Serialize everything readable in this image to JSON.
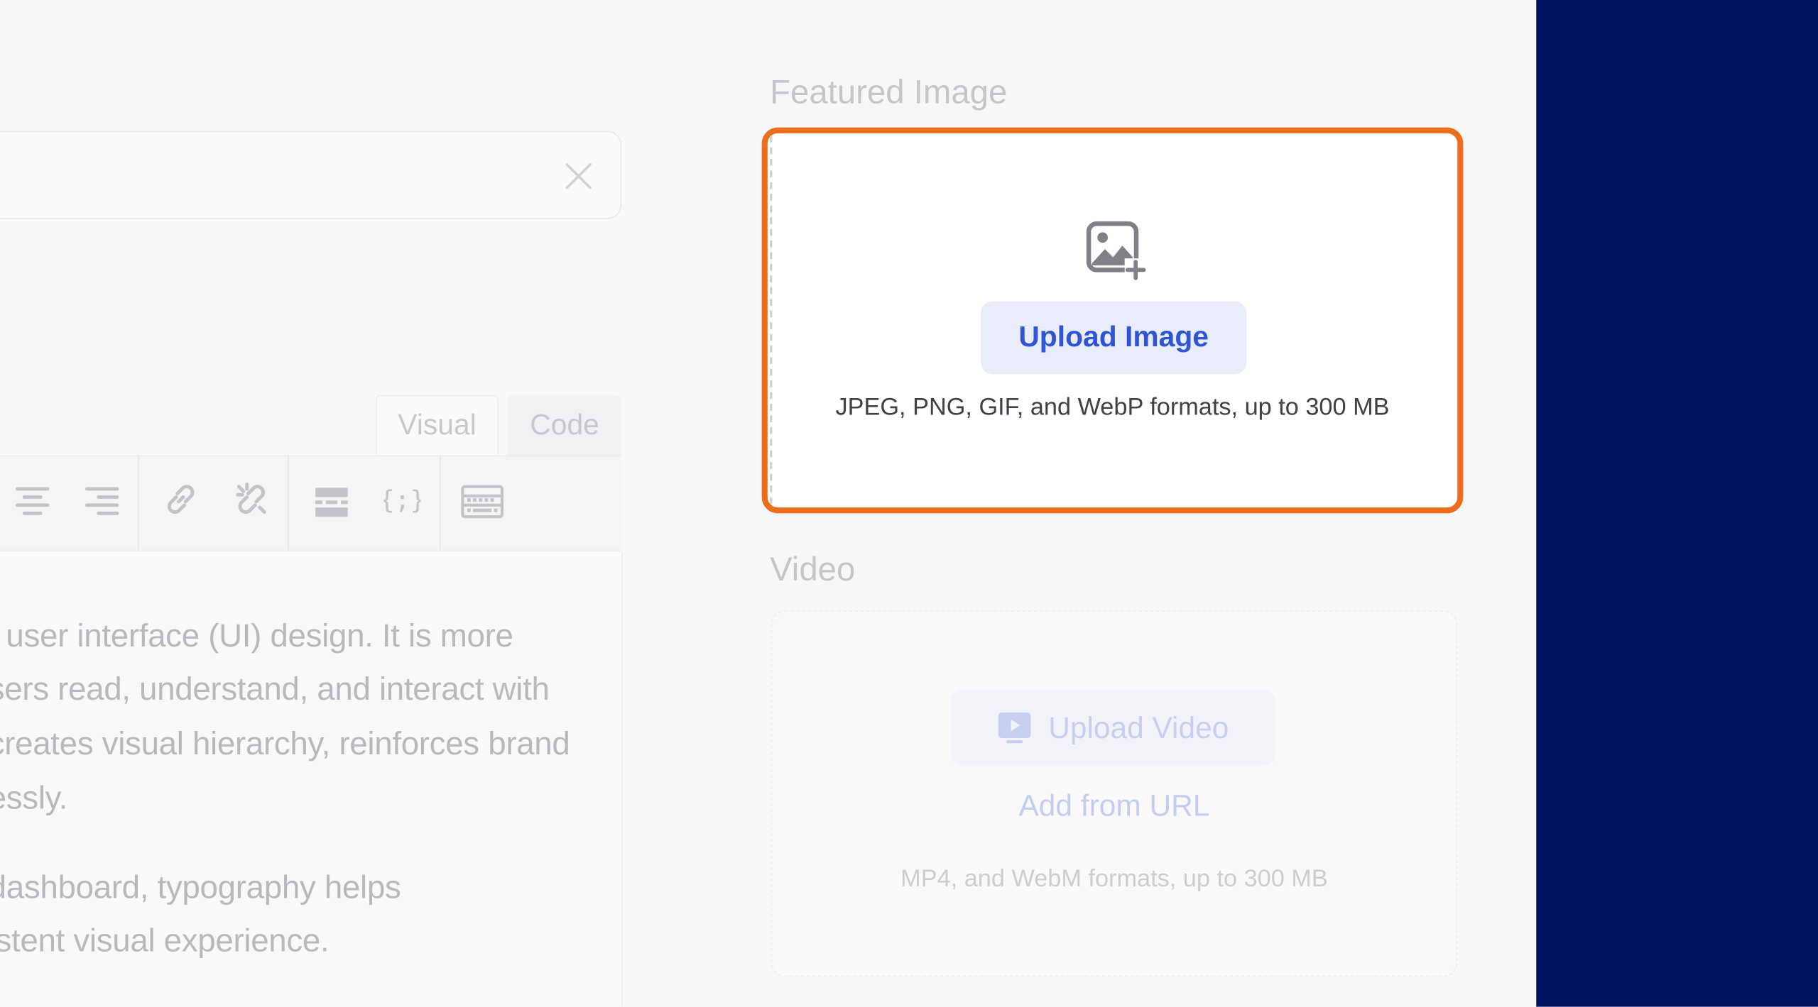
{
  "editor": {
    "tabs": [
      {
        "label": "Visual",
        "active": true
      },
      {
        "label": "Code",
        "active": false
      }
    ],
    "toolbar_icons": [
      "align-center-icon",
      "align-right-icon",
      "link-icon",
      "unlink-icon",
      "horizontal-rule-icon",
      "code-block-icon",
      "keyboard-icon"
    ],
    "content_lines": [
      "f user interface (UI) design. It is more",
      "sers read, understand, and interact with",
      "creates visual hierarchy, reinforces brand",
      "essly.",
      "dashboard, typography helps",
      "istent visual experience."
    ]
  },
  "featured_image": {
    "label": "Featured Image",
    "upload_button": "Upload Image",
    "formats": "JPEG, PNG, GIF, and WebP formats, up to 300 MB",
    "icon": "image-add-icon",
    "highlight_color": "#ec6d1b"
  },
  "video": {
    "label": "Video",
    "upload_button": "Upload Video",
    "add_url": "Add from URL",
    "formats": "MP4, and WebM formats, up to 300 MB",
    "icon": "video-play-icon"
  },
  "colors": {
    "accent": "#2f55d4",
    "side_panel": "#00135c"
  }
}
